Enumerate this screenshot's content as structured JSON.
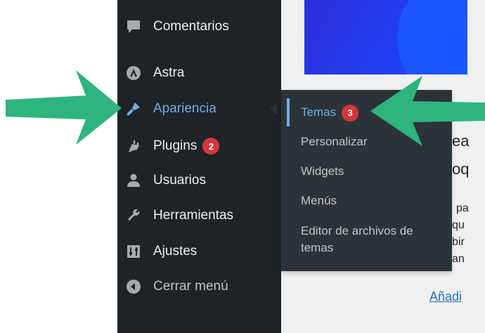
{
  "sidebar": {
    "items": [
      {
        "label": "Comentarios",
        "icon": "comment-icon"
      },
      {
        "label": "Astra",
        "icon": "astra-icon"
      },
      {
        "label": "Apariencia",
        "icon": "paintbrush-icon"
      },
      {
        "label": "Plugins",
        "icon": "plug-icon",
        "badge": "2"
      },
      {
        "label": "Usuarios",
        "icon": "user-icon"
      },
      {
        "label": "Herramientas",
        "icon": "wrench-icon"
      },
      {
        "label": "Ajustes",
        "icon": "sliders-icon"
      },
      {
        "label": "Cerrar menú",
        "icon": "collapse-icon"
      }
    ]
  },
  "submenu": {
    "items": [
      {
        "label": "Temas",
        "badge": "3"
      },
      {
        "label": "Personalizar"
      },
      {
        "label": "Widgets"
      },
      {
        "label": "Menús"
      },
      {
        "label": "Editor de archivos de temas"
      }
    ]
  },
  "background": {
    "partial_texts": [
      "ea",
      "oq",
      "pa",
      "qu",
      "bir",
      "an"
    ],
    "link": "Añadi"
  },
  "colors": {
    "sidebar_bg": "#1d2327",
    "submenu_bg": "#2c3338",
    "accent": "#72aee6",
    "badge": "#d63638",
    "arrow": "#2fb37f"
  }
}
